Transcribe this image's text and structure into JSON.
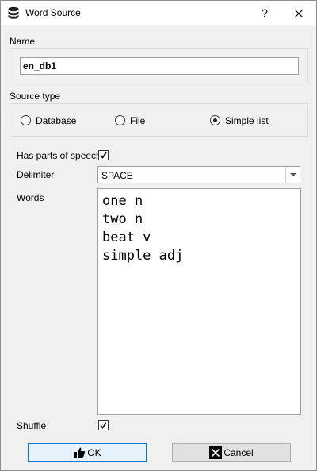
{
  "window": {
    "title": "Word Source",
    "help": "?",
    "close": "✕"
  },
  "name_section": {
    "label": "Name",
    "value": "en_db1"
  },
  "source_type": {
    "label": "Source type",
    "options": [
      "Database",
      "File",
      "Simple list"
    ],
    "selected": "Simple list"
  },
  "has_pos": {
    "label": "Has parts of speech",
    "checked": true
  },
  "delimiter": {
    "label": "Delimiter",
    "value": "SPACE"
  },
  "words": {
    "label": "Words",
    "value": "one n\ntwo n\nbeat v\nsimple adj"
  },
  "shuffle": {
    "label": "Shuffle",
    "checked": true
  },
  "buttons": {
    "ok": "OK",
    "cancel": "Cancel"
  }
}
